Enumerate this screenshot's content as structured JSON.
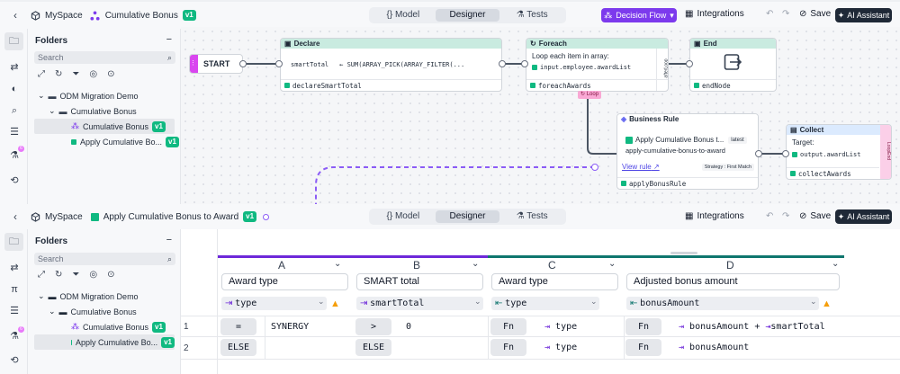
{
  "top": {
    "space": "MySpace",
    "title": "Cumulative Bonus",
    "version": "v1",
    "tabs": [
      "{} Model",
      "Designer",
      "Tests"
    ],
    "flow": "Decision Flow",
    "integrations": "Integrations",
    "save": "Save",
    "ai": "AI Assistant"
  },
  "bottom": {
    "space": "MySpace",
    "title": "Apply Cumulative Bonus to Award",
    "version": "v1",
    "tabs": [
      "{} Model",
      "Designer",
      "Tests"
    ],
    "integrations": "Integrations",
    "save": "Save",
    "ai": "AI Assistant"
  },
  "sidebar": {
    "header": "Folders",
    "search_placeholder": "Search",
    "tree": [
      {
        "label": "ODM Migration Demo",
        "level": 0
      },
      {
        "label": "Cumulative Bonus",
        "level": 1
      },
      {
        "label": "Cumulative Bonus",
        "level": 2,
        "badge": "v1"
      },
      {
        "label": "Apply Cumulative Bo...",
        "level": 2,
        "badge": "v1"
      }
    ]
  },
  "rail_badge": "6",
  "flow": {
    "start": "START",
    "declare": {
      "title": "Declare",
      "var": "smartTotal",
      "expr": "← SUM(ARRAY_PICK(ARRAY_FILTER(...",
      "footer": "declareSmartTotal"
    },
    "foreach": {
      "title": "Foreach",
      "line1": "Loop each item in array:",
      "line2": "input.employee.awardList",
      "footer": "foreachAwards",
      "side": "afterLoop",
      "loop": "Loop"
    },
    "end": {
      "title": "End",
      "footer": "endNode"
    },
    "rule": {
      "title": "Business Rule",
      "name": "Apply Cumulative Bonus t...",
      "tag": "latest",
      "id": "apply-cumulative-bonus-to-award",
      "link": "View rule",
      "strategy": "Strategy : First Match",
      "footer": "applyBonusRule"
    },
    "collect": {
      "title": "Collect",
      "target": "Target:",
      "path": "output.awardList",
      "footer": "collectAwards",
      "side": "LoopEnd"
    }
  },
  "table": {
    "columns": [
      {
        "letter": "A",
        "name": "Award type",
        "type": "type",
        "warn": true
      },
      {
        "letter": "B",
        "name": "SMART total",
        "type": "smartTotal",
        "warn": false
      },
      {
        "letter": "C",
        "name": "Award type",
        "type": "type",
        "warn": false
      },
      {
        "letter": "D",
        "name": "Adjusted bonus amount",
        "type": "bonusAmount",
        "warn": true
      }
    ],
    "rows": [
      {
        "n": "1",
        "a_op": "=",
        "a_val": "SYNERGY",
        "b_op": ">",
        "b_val": "0",
        "c_op": "Fn",
        "c_val": "type",
        "d_op": "Fn",
        "d_val1": "bonusAmount",
        "d_plus": "+",
        "d_val2": "smartTotal"
      },
      {
        "n": "2",
        "a_op": "ELSE",
        "a_val": "",
        "b_op": "ELSE",
        "b_val": "",
        "c_op": "Fn",
        "c_val": "type",
        "d_op": "Fn",
        "d_val1": "bonusAmount"
      }
    ]
  }
}
